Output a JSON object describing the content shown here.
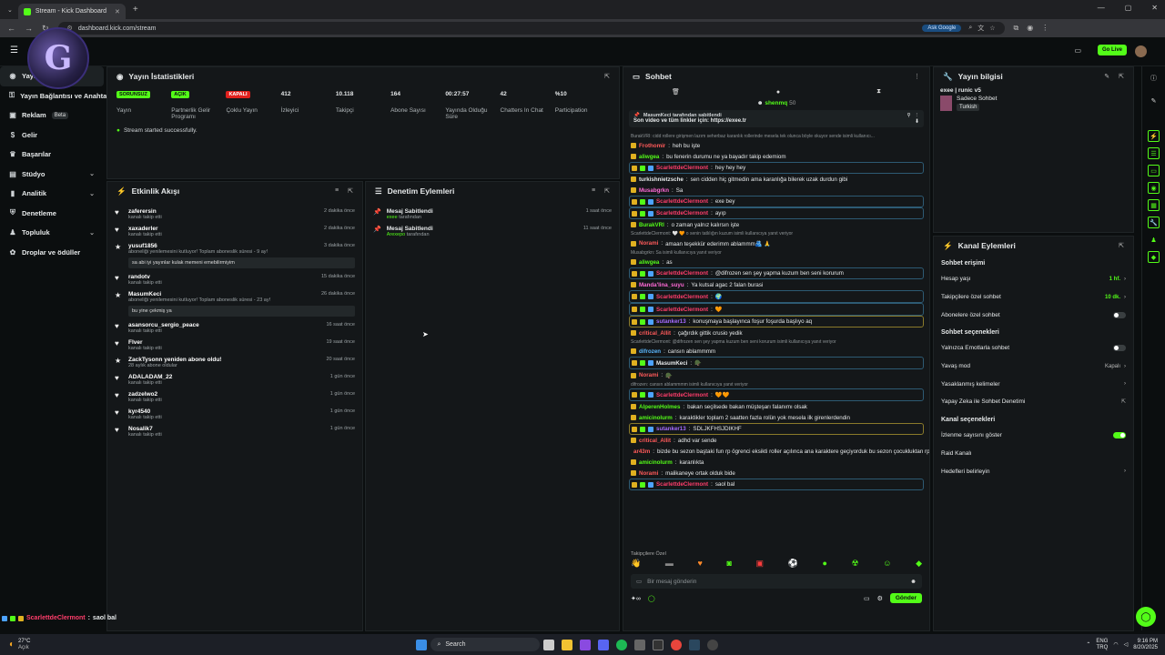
{
  "browser": {
    "tab_title": "Stream - Kick Dashboard",
    "url": "dashboard.kick.com/stream",
    "ask_google": "Ask Google"
  },
  "header": {
    "go_live": "Go Live"
  },
  "sidebar": {
    "items": [
      {
        "label": "Yayın",
        "icon": "signal-icon"
      },
      {
        "label": "Yayın Bağlantısı ve Anahtarı",
        "icon": "link-icon"
      },
      {
        "label": "Reklam",
        "icon": "ad-icon",
        "badge": "Beta"
      },
      {
        "label": "Gelir",
        "icon": "money-icon"
      },
      {
        "label": "Başarılar",
        "icon": "trophy-icon"
      },
      {
        "label": "Stüdyo",
        "icon": "studio-icon"
      },
      {
        "label": "Analitik",
        "icon": "chart-icon"
      },
      {
        "label": "Denetleme",
        "icon": "shield-icon"
      },
      {
        "label": "Topluluk",
        "icon": "community-icon"
      },
      {
        "label": "Droplar ve ödüller",
        "icon": "gift-icon"
      }
    ]
  },
  "stats": {
    "title": "Yayın İstatistikleri",
    "items": [
      {
        "value": "SORUNSUZ",
        "label": "Yayın",
        "badge": "green"
      },
      {
        "value": "AÇIK",
        "label": "Partnerlik Gelir Programı",
        "badge": "green"
      },
      {
        "value": "KAPALI",
        "label": "Çoklu Yayın",
        "badge": "red"
      },
      {
        "value": "412",
        "label": "İzleyici"
      },
      {
        "value": "10.118",
        "label": "Takipçi"
      },
      {
        "value": "164",
        "label": "Abone Sayısı"
      },
      {
        "value": "00:27:57",
        "label": "Yayında Olduğu Süre"
      },
      {
        "value": "42",
        "label": "Chatters In Chat"
      },
      {
        "value": "%10",
        "label": "Participation"
      }
    ],
    "success": "Stream started successfully."
  },
  "activity": {
    "title": "Etkinlik Akışı",
    "events": [
      {
        "user": "zaferersin",
        "desc": "kanalı takip etti",
        "time": "2 dakika önce",
        "icon": "heart-icon"
      },
      {
        "user": "xaxaderler",
        "desc": "kanalı takip etti",
        "time": "2 dakika önce",
        "icon": "heart-icon"
      },
      {
        "user": "yusuf1856",
        "desc": "aboneliği yenilemesini kutluyor! Toplam aboneslik süresi - 9 ay!",
        "time": "3 dakika önce",
        "icon": "star-icon",
        "msg": "sa abi iyi yayınlar kulak memeni emebilirmiyim"
      },
      {
        "user": "randotv",
        "desc": "kanalı takip etti",
        "time": "15 dakika önce",
        "icon": "heart-icon"
      },
      {
        "user": "MasumKeci",
        "desc": "aboneliği yenilemesini kutluyor! Toplam aboneslik süresi - 23 ay!",
        "time": "26 dakika önce",
        "icon": "star-icon",
        "msg": "bu yine çekmiş ya"
      },
      {
        "user": "asansorcu_sergio_peace",
        "desc": "kanalı takip etti",
        "time": "16 saat önce",
        "icon": "heart-icon"
      },
      {
        "user": "Flver",
        "desc": "kanalı takip etti",
        "time": "19 saat önce",
        "icon": "heart-icon"
      },
      {
        "user": "ZackTysonn yeniden abone oldu!",
        "desc": "28 aylık abone oldular",
        "time": "20 saat önce",
        "icon": "star-icon"
      },
      {
        "user": "ADALADAM_22",
        "desc": "kanalı takip etti",
        "time": "1 gün önce",
        "icon": "heart-icon"
      },
      {
        "user": "zadzelwo2",
        "desc": "kanalı takip etti",
        "time": "1 gün önce",
        "icon": "heart-icon"
      },
      {
        "user": "kyr4540",
        "desc": "kanalı takip etti",
        "time": "1 gün önce",
        "icon": "heart-icon"
      },
      {
        "user": "Nosalik7",
        "desc": "kanalı takip etti",
        "time": "1 gün önce",
        "icon": "heart-icon"
      }
    ]
  },
  "moderation": {
    "title": "Denetim Eylemleri",
    "actions": [
      {
        "title": "Mesaj Sabitlendi",
        "by": "exee",
        "suffix": "tarafından",
        "time": "1 saat önce"
      },
      {
        "title": "Mesaj Sabitlendi",
        "by": "Arexepo",
        "suffix": "tarafından",
        "time": "11 saat önce"
      }
    ]
  },
  "chat": {
    "title": "Sohbet",
    "viewer_user": "shenmq",
    "viewer_count": "50",
    "pinned_by": "MasumKeci tarafından sabitlendi",
    "pinned_text": "Son video ve tüm linkler için: https://exee.tr",
    "messages": [
      {
        "reply": "BurakVRI: cidd rollere girişmen lazım seherbaz karanlık rollerinde mesela tek olunca böyle okuyor sende isimli kullanıcı...",
        "user": "Frothomir",
        "color": "#ff5a5a",
        "text": "heh bu işte"
      },
      {
        "user": "aliwgea",
        "color": "#53fc18",
        "text": "bu fenerin durumu ne ya bayadır takip edemiom"
      },
      {
        "user": "ScarlettdeClermont",
        "color": "#ff3d6b",
        "text": "hey hey hey",
        "style": "hl"
      },
      {
        "user": "turkishnietzsche",
        "color": "#e6e9ea",
        "text": "sen cidden hiç gitmedin ama karanlığa bilerek uzak durdun gibi"
      },
      {
        "user": "Musabgrkn",
        "color": "#ff6ad5",
        "text": "Sa"
      },
      {
        "user": "ScarlettdeClermont",
        "color": "#ff3d6b",
        "text": "exe bey",
        "style": "hl"
      },
      {
        "user": "ScarlettdeClermont",
        "color": "#ff3d6b",
        "text": "ayıp",
        "style": "hl"
      },
      {
        "user": "BurakVRI",
        "color": "#53fc18",
        "text": "o zaman yalnız kalırsın işte"
      },
      {
        "reply": "ScarlettdeClermont: 🤍 🧡 o senin tatlılığın kuzum isimli kullanıcıya yanıt veriyor",
        "user": "Norami",
        "color": "#ff5a5a",
        "text": "amaan teşekkür ederimm ablammm🫂 🙏"
      },
      {
        "reply": "Musabgrkn: Sa isimli kullanıcıya yanıt veriyor",
        "user": "aliwgea",
        "color": "#53fc18",
        "text": "as"
      },
      {
        "user": "ScarlettdeClermont",
        "color": "#ff3d6b",
        "text": "@difrozen sen şey yapma kuzum ben seni korurum",
        "style": "hl"
      },
      {
        "user": "Manda'lina_suyu",
        "color": "#ff6ad5",
        "text": "Ya kutsal agac 2 falan burasi"
      },
      {
        "user": "ScarlettdeClermont",
        "color": "#ff3d6b",
        "text": "🌍",
        "style": "hl"
      },
      {
        "user": "ScarlettdeClermont",
        "color": "#ff3d6b",
        "text": "🧡",
        "style": "hl"
      },
      {
        "user": "sutanker13",
        "color": "#a66bff",
        "text": "konuşmaya başlayınca foşur foşurda başlıyo aq",
        "style": "gold"
      },
      {
        "user": "critical_Allit",
        "color": "#ff5a5a",
        "text": "çağırdık gittik crusio yedik"
      },
      {
        "reply": "ScarlettdeClermont: @difrozen sen şey yapma kuzum ben seni korurum isimli kullanıcıya yanıt veriyor",
        "user": "difrozen",
        "color": "#5ab8ff",
        "text": "cansın ablammmm"
      },
      {
        "user": "MasumKeci",
        "color": "#e6e9ea",
        "text": "🪖",
        "style": "hl"
      },
      {
        "user": "Norami",
        "color": "#ff5a5a",
        "text": "🪖"
      },
      {
        "reply": "difrozen: cansın ablammmm isimli kullanıcıya yanıt veriyor",
        "user": "ScarlettdeClermont",
        "color": "#ff3d6b",
        "text": "🧡🧡",
        "style": "hl"
      },
      {
        "user": "AlperenHolmes",
        "color": "#53fc18",
        "text": "bakan seçilsede bakan müşteşarı falanımı olsak"
      },
      {
        "user": "amicinolurm",
        "color": "#53fc18",
        "text": "karaktikler toplam 2 saatten fazla rolün yok mesela ilk girenlerdendin"
      },
      {
        "user": "sutanker13",
        "color": "#a66bff",
        "text": "SDLJKFHSJDIKHF",
        "style": "gold"
      },
      {
        "user": "critical_Allit",
        "color": "#ff5a5a",
        "text": "adhd var sende"
      },
      {
        "user": "ar43m",
        "color": "#ff5a5a",
        "text": "bizde bu sezon baştaki fun rp ögrenci eksikti roller açılınca ana karaktere geçiyorduk bu sezon çocukluktan rpler oldugundan diydir belki"
      },
      {
        "user": "amicinolurm",
        "color": "#53fc18",
        "text": "karanlıkta"
      },
      {
        "user": "Norami",
        "color": "#ff5a5a",
        "text": "malikaneye ortak olduk bide"
      },
      {
        "user": "ScarlettdeClermont",
        "color": "#ff3d6b",
        "text": "saol bal",
        "style": "hl"
      }
    ],
    "emote_section": "Takipçilere Özel",
    "input_placeholder": "Bir mesaj gönderin",
    "send_label": "Gönder"
  },
  "stream_info": {
    "title": "Yayın bilgisi",
    "stream_title": "exee | runic v5",
    "category": "Sadece Sohbet",
    "language": "Turkish"
  },
  "channel_actions": {
    "title": "Kanal Eylemleri",
    "chat_access": "Sohbet erişimi",
    "rows1": [
      {
        "label": "Hesap yaşı",
        "value": "1 hf.",
        "kind": "chevron",
        "accent": true
      },
      {
        "label": "Takipçilere özel sohbet",
        "value": "10 dk.",
        "kind": "chevron",
        "accent": true
      },
      {
        "label": "Abonelere özel sohbet",
        "value": "",
        "kind": "toggle-off"
      }
    ],
    "chat_options": "Sohbet seçenekleri",
    "rows2": [
      {
        "label": "Yalnızca Emotlarla sohbet",
        "value": "",
        "kind": "toggle-off"
      },
      {
        "label": "Yavaş mod",
        "value": "Kapalı",
        "kind": "chevron"
      },
      {
        "label": "Yasaklanmış kelimeler",
        "value": "",
        "kind": "chevron"
      },
      {
        "label": "Yapay Zeka ile Sohbet Denetimi",
        "value": "",
        "kind": "external"
      }
    ],
    "channel_options": "Kanal seçenekleri",
    "rows3": [
      {
        "label": "İzlenme sayısını göster",
        "value": "",
        "kind": "toggle-on"
      },
      {
        "label": "Raid Kanalı",
        "value": "",
        "kind": "none"
      },
      {
        "label": "Hedefleri belirleyin",
        "value": "",
        "kind": "chevron"
      }
    ]
  },
  "overlay_chat": {
    "user": "ScarlettdeClermont",
    "text": "saol bal"
  },
  "taskbar": {
    "weather_temp": "27°C",
    "weather_desc": "Açık",
    "search": "Search",
    "lang": "ENG",
    "lang2": "TRQ",
    "time": "9:16 PM",
    "date": "8/20/2025"
  }
}
